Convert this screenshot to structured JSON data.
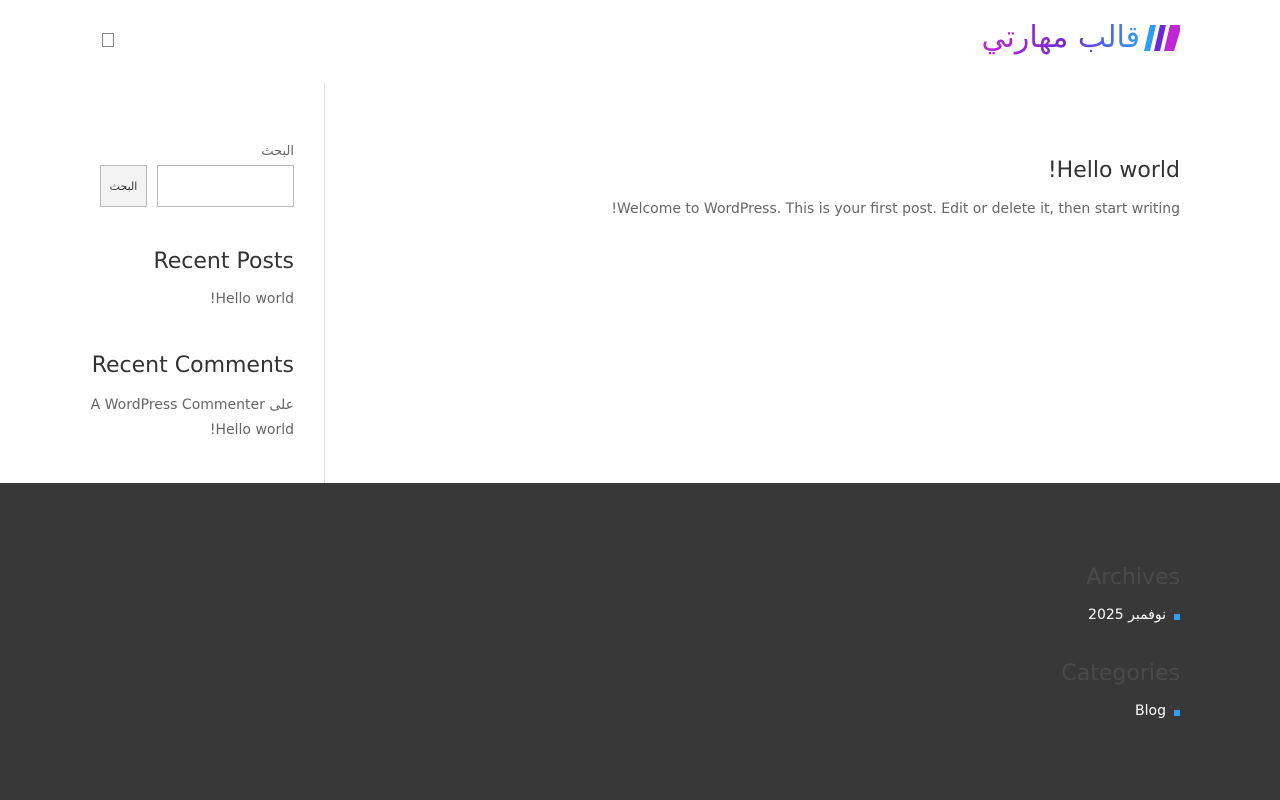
{
  "header": {
    "logo_text": "قالب مهارتي",
    "menu_icon": "hamburger-menu-icon"
  },
  "post": {
    "title": "!Hello world",
    "excerpt": "!Welcome to WordPress. This is your first post. Edit or delete it, then start writing"
  },
  "sidebar": {
    "search_label": "البحث",
    "search_button": "البحث",
    "search_value": "",
    "recent_posts_title": "Recent Posts",
    "recent_posts": [
      "!Hello world"
    ],
    "recent_comments_title": "Recent Comments",
    "recent_comment_line1": "A WordPress Commenter على",
    "recent_comment_line2": "!Hello world"
  },
  "footer": {
    "archives_title": "Archives",
    "archive_item": "نوفمبر 2025",
    "categories_title": "Categories",
    "category_item": "Blog"
  },
  "colors": {
    "footer_bg": "#383838",
    "accent": "#2ea3f2",
    "logo_gradient": [
      "#c026d3",
      "#6d28d9",
      "#2f9cf5"
    ]
  }
}
